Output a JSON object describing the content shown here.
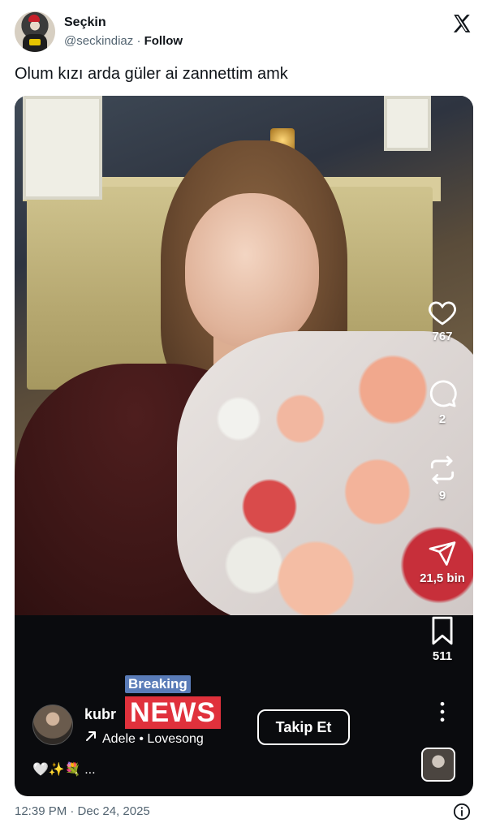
{
  "tweet": {
    "author_name": "Seçkin",
    "handle": "@seckindiaz",
    "separator": "·",
    "follow_label": "Follow",
    "text": "Olum kızı arda güler ai zannettim amk",
    "timestamp": "12:39 PM · Dec 24, 2025"
  },
  "media": {
    "rail": {
      "likes": "767",
      "comments": "2",
      "reposts": "9",
      "shares": "21,5 bin",
      "saves": "511"
    },
    "author_short": "kubr",
    "overlay_breaking": "Breaking",
    "overlay_news": "NEWS",
    "song": "Adele • Lovesong",
    "follow_button": "Takip Et",
    "caption": "🤍✨💐 ..."
  },
  "colors": {
    "text": "#0f1419",
    "muted": "#536471",
    "breaking_blue": "#5a7cb8",
    "news_red": "#e0313c",
    "media_bg": "#0a0b0e"
  }
}
